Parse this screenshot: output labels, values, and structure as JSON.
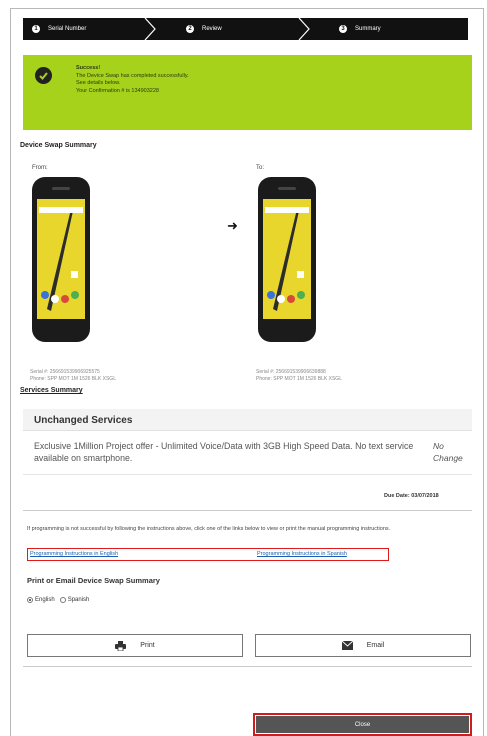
{
  "stepper": {
    "steps": [
      {
        "number": "1",
        "label": "Serial Number"
      },
      {
        "number": "2",
        "label": "Review"
      },
      {
        "number": "3",
        "label": "Summary"
      }
    ]
  },
  "success": {
    "title": "Success!",
    "line1": "The Device Swap has completed successfully.",
    "line2": "See details below.",
    "line3": "Your Confirmation # is 134903228"
  },
  "summary": {
    "title": "Device Swap Summary",
    "from_label": "From:",
    "to_label": "To:",
    "from_serial": "Serial #: 256691539906925575",
    "from_phone": "Phone: SPP MOT 1M 1526 BLK XSGL",
    "to_serial": "Serial #: 256691539906639888",
    "to_phone": "Phone: SPP MOT 1M 1526 BLK XSGL"
  },
  "services": {
    "title": "Services Summary",
    "header": "Unchanged Services",
    "rows": [
      {
        "description": "Exclusive 1Million Project offer - Unlimited Voice/Data with 3GB High Speed Data. No text service available on smartphone.",
        "status": "No Change"
      }
    ]
  },
  "due_date": "Due Date: 03/07/2018",
  "programming": {
    "note": "If programming is not successful by following the instructions above, click one of the links below to view or print the manual programming instructions.",
    "link_english": "Programming Instructions in English",
    "link_spanish": "Programming Instructions in Spanish"
  },
  "print_email": {
    "title": "Print or Email Device Swap Summary",
    "lang_english": "English",
    "lang_spanish": "Spanish",
    "selected_language": "English",
    "print_label": "Print",
    "email_label": "Email"
  },
  "close_label": "Close",
  "colors": {
    "success_bg": "#a6d21c",
    "stepper_bg": "#111111",
    "link": "#1a5fb4",
    "highlight_border": "#e01b1b",
    "close_bg": "#555555"
  },
  "icons": {
    "step": "step-number-icon",
    "success": "check-circle-icon",
    "arrow": "arrow-right-icon",
    "print": "printer-icon",
    "email": "envelope-icon"
  }
}
